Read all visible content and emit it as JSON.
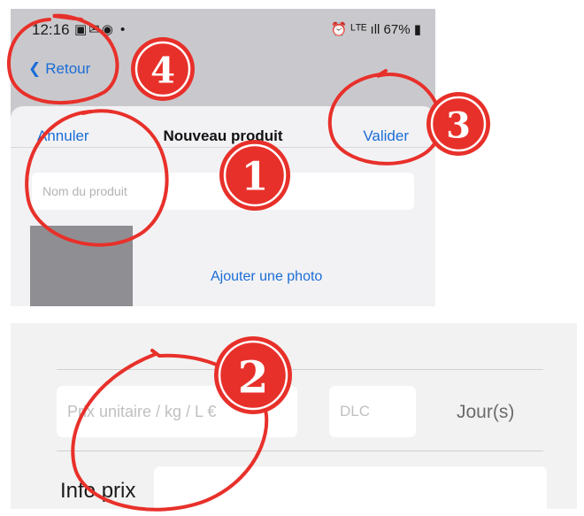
{
  "top_screen": {
    "status_bar": {
      "time": "12:16",
      "left_icons": "▣✉◉ •",
      "right_icons": "⏰ ᴸᵀᴱ ıll 67% ▮"
    },
    "nav": {
      "back_label": "Retour"
    },
    "sheet": {
      "cancel_label": "Annuler",
      "title": "Nouveau produit",
      "validate_label": "Valider",
      "name_placeholder": "Nom du produit",
      "add_photo_label": "Ajouter une photo"
    }
  },
  "bottom_screen": {
    "price_placeholder": "Prix unitaire / kg / L €",
    "dlc_placeholder": "DLC",
    "days_label": "Jour(s)",
    "info_label": "Info prix"
  },
  "annotations": {
    "color": "#e8302a",
    "badges": [
      "1",
      "2",
      "3",
      "4"
    ]
  }
}
